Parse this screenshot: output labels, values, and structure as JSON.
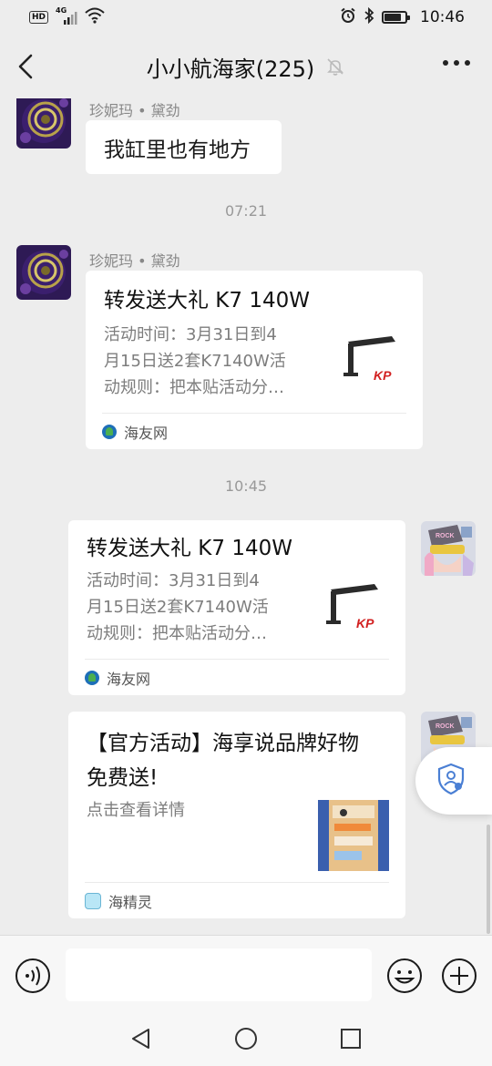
{
  "status_bar": {
    "hd": "HD",
    "network": "4G",
    "time": "10:46",
    "battery_level": 0.8,
    "icons": [
      "signal-icon",
      "wifi-icon",
      "alarm-icon",
      "bluetooth-icon",
      "battery-icon"
    ]
  },
  "header": {
    "title": "小小航海家(225)",
    "icons": [
      "back-arrow-icon",
      "mute-bell-icon",
      "more-icon"
    ]
  },
  "messages": [
    {
      "sender": "珍妮玛 • 黛劲",
      "text": "我缸里也有地方"
    },
    {
      "timestamp": "07:21"
    },
    {
      "sender": "珍妮玛 • 黛劲",
      "card": {
        "title": "转发送大礼 K7 140W",
        "desc_lines": [
          "活动时间：3月31日到4",
          "月15日送2套K7140W活",
          "动规则：把本贴活动分…"
        ],
        "source": "海友网",
        "thumb_badge": "KP"
      }
    },
    {
      "timestamp": "10:45"
    },
    {
      "self": true,
      "card": {
        "title": "转发送大礼 K7 140W",
        "desc_lines": [
          "活动时间：3月31日到4",
          "月15日送2套K7140W活",
          "动规则：把本贴活动分…"
        ],
        "source": "海友网",
        "thumb_badge": "KP"
      }
    },
    {
      "self": true,
      "card": {
        "title_lines": [
          "【官方活动】海享说品牌好物",
          "免费送!"
        ],
        "desc": "点击查看详情",
        "source": "海精灵"
      }
    }
  ],
  "input_bar": {
    "placeholder": "",
    "icons": [
      "voice-icon",
      "emoji-icon",
      "plus-icon"
    ]
  },
  "floating": {
    "icon": "shield-icon"
  },
  "nav_bar": {
    "icons": [
      "nav-back-icon",
      "nav-home-icon",
      "nav-recent-icon"
    ]
  },
  "colors": {
    "chat_bg": "#ededed",
    "bubble": "#ffffff",
    "muted_text": "#888888",
    "thumb_red": "#d22020"
  }
}
